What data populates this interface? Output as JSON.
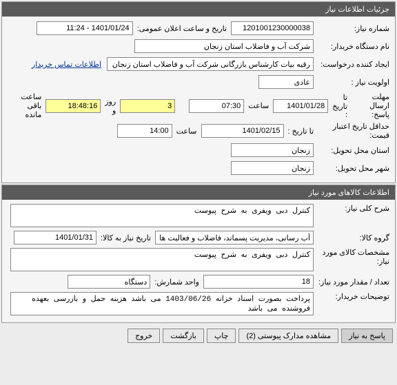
{
  "panel1": {
    "title": "جزئیات اطلاعات نیاز",
    "need_no_label": "شماره نیاز:",
    "need_no": "1201001230000038",
    "pub_dt_label": "تاریخ و ساعت اعلان عمومی:",
    "pub_dt": "1401/01/24 - 11:24",
    "buyer_org_label": "نام دستگاه خریدار:",
    "buyer_org": "شرکت آب و فاضلاب استان زنجان",
    "creator_label": "ایجاد کننده درخواست:",
    "creator": "رقیه بیات کارشناس بازرگانی شرکت آب و فاضلاب استان زنجان",
    "contact_link": "اطلاعات تماس خریدار",
    "priority_label": "اولویت نیاز :",
    "priority": "عادی",
    "deadline_label": "مهلت ارسال پاسخ:",
    "deadline_to_label": "تا تاریخ :",
    "deadline_date": "1401/01/28",
    "at_label": "ساعت",
    "deadline_time": "07:30",
    "days_left": "3",
    "days_label": "روز و",
    "hours_left": "18:48:16",
    "remain_label": "ساعت باقی مانده",
    "price_validity_label": "حداقل تاریخ اعتبار قیمت:",
    "price_to_label": "تا تاریخ :",
    "price_date": "1401/02/15",
    "price_time": "14:00",
    "deliver_prov_label": "استان محل تحویل:",
    "deliver_prov": "زنجان",
    "deliver_city_label": "شهر محل تحویل:",
    "deliver_city": "زنجان"
  },
  "panel2": {
    "title": "اطلاعات کالاهای مورد نیاز",
    "desc_label": "شرح کلی نیاز:",
    "desc": "کنترل دبی ویفری به شرح پیوست",
    "group_label": "گروه کالا:",
    "group": "آب رسانی، مدیریت پسماند، فاضلاب و فعالیت ها:",
    "need_date_label": "تاریخ نیاز به کالا:",
    "need_date": "1401/01/31",
    "spec_label": "مشخصات کالای مورد نیاز:",
    "spec": "کنترل دبی ویفری به شرح پیوست",
    "qty_label": "تعداد / مقدار مورد نیاز:",
    "qty": "18",
    "unit_label": "واحد شمارش:",
    "unit": "دستگاه",
    "buyer_note_label": "توضیحات خریدار:",
    "buyer_note": "پرداخت بصورت اسناد خزانه 1403/06/26 می باشد هزینه حمل و بازرسی بعهده فروشنده می باشد"
  },
  "footer": {
    "reply": "پاسخ به نیاز",
    "attach": "مشاهده مدارک پیوستی (2)",
    "print": "چاپ",
    "back": "بازگشت",
    "exit": "خروج"
  }
}
